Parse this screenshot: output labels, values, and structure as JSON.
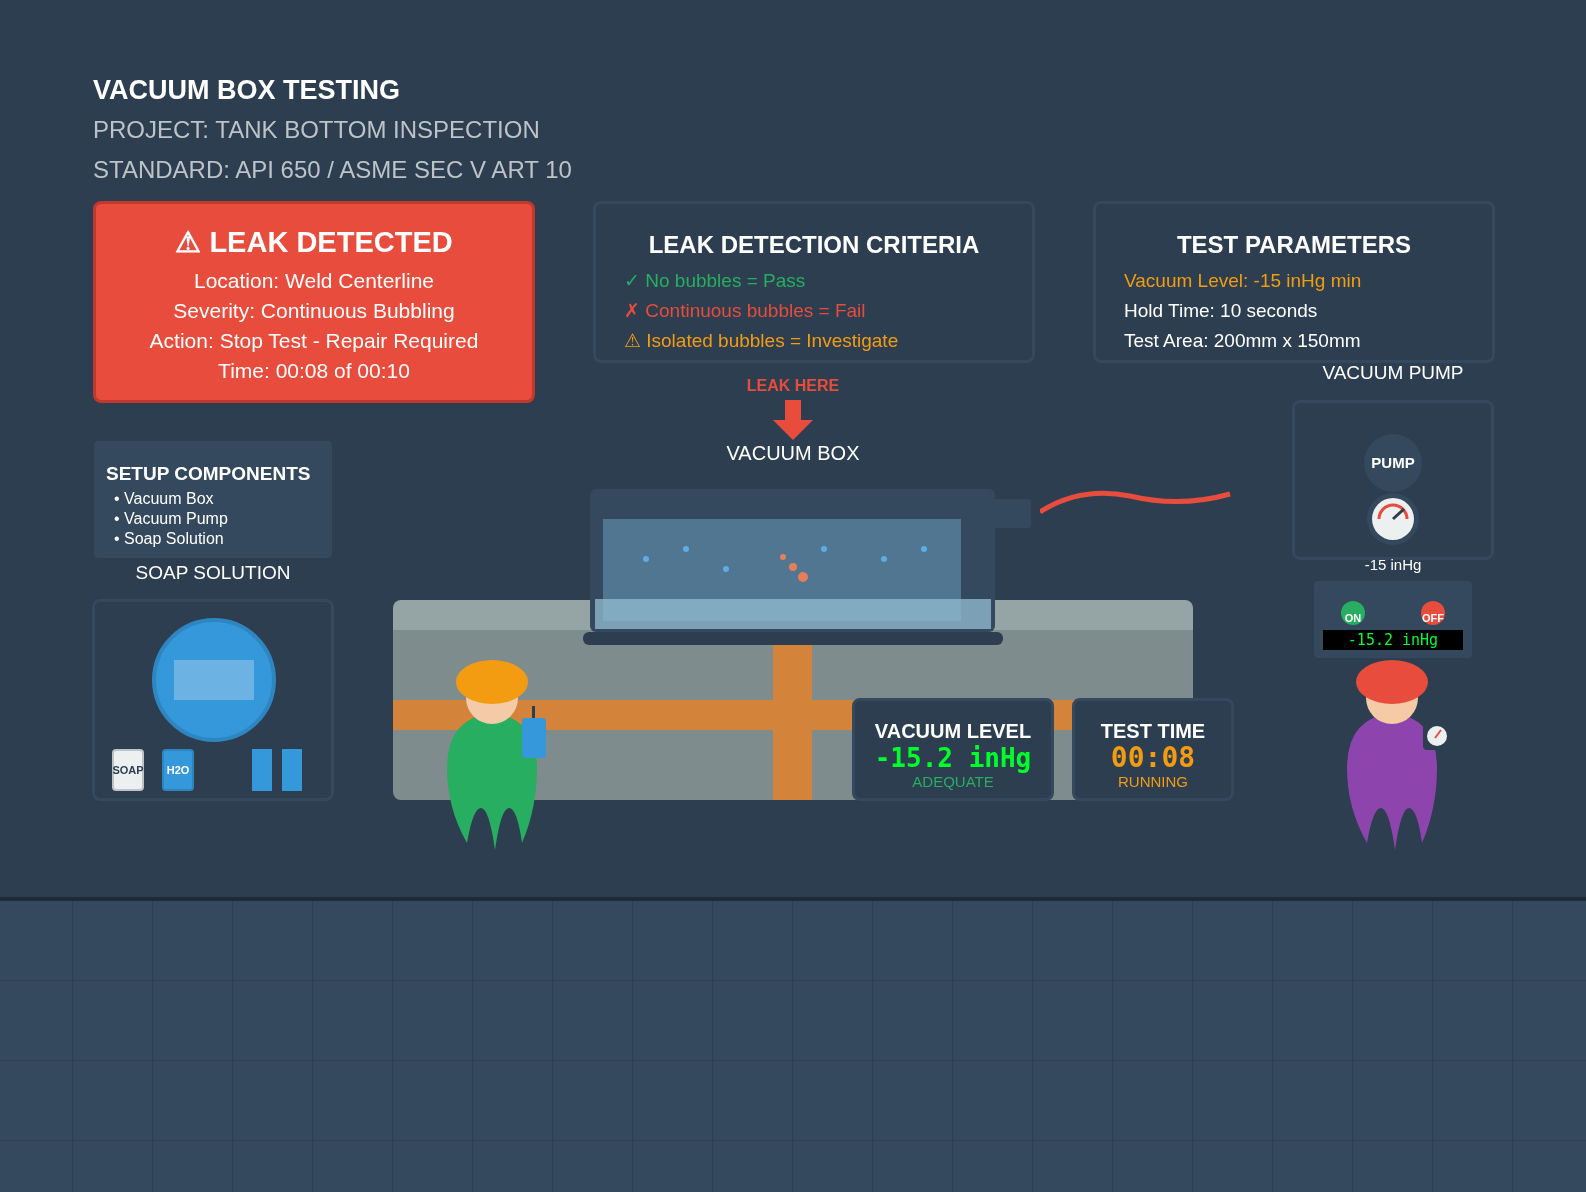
{
  "header": {
    "title": "VACUUM BOX TESTING",
    "project": "PROJECT: TANK BOTTOM INSPECTION",
    "standard": "STANDARD: API 650 / ASME SEC V ART 10"
  },
  "alert": {
    "title": "⚠ LEAK DETECTED",
    "lines": [
      "Location: Weld Centerline",
      "Severity: Continuous Bubbling",
      "Action: Stop Test - Repair Required",
      "Time: 00:08 of 00:10"
    ]
  },
  "criteria": {
    "title": "LEAK DETECTION CRITERIA",
    "items": [
      {
        "text": "✓ No bubbles = Pass",
        "kind": "pass"
      },
      {
        "text": "✗ Continuous bubbles = Fail",
        "kind": "fail"
      },
      {
        "text": "⚠ Isolated bubbles = Investigate",
        "kind": "investigate"
      }
    ]
  },
  "parameters": {
    "title": "TEST PARAMETERS",
    "items": [
      {
        "text": "Vacuum Level: -15 inHg min",
        "color": "#f39c12"
      },
      {
        "text": "Hold Time: 10 seconds",
        "color": "#ffffff"
      },
      {
        "text": "Test Area: 200mm x 150mm",
        "color": "#ffffff"
      }
    ]
  },
  "setup": {
    "title": "SETUP COMPONENTS",
    "items": [
      "• Vacuum Box",
      "• Vacuum Pump",
      "• Soap Solution"
    ]
  },
  "soap": {
    "label": "SOAP SOLUTION",
    "containers": [
      "SOAP",
      "H2O"
    ]
  },
  "leak_marker": "LEAK HERE",
  "vacuum_box_label": "VACUUM BOX",
  "pump": {
    "label": "VACUUM PUMP",
    "badge": "PUMP",
    "gauge_reading": "-15 inHg",
    "on": "ON",
    "off": "OFF",
    "display": "-15.2 inHg"
  },
  "vacuum_level": {
    "title": "VACUUM LEVEL",
    "value": "-15.2 inHg",
    "status": "ADEQUATE"
  },
  "test_time": {
    "title": "TEST TIME",
    "value": "00:08",
    "status": "RUNNING"
  }
}
